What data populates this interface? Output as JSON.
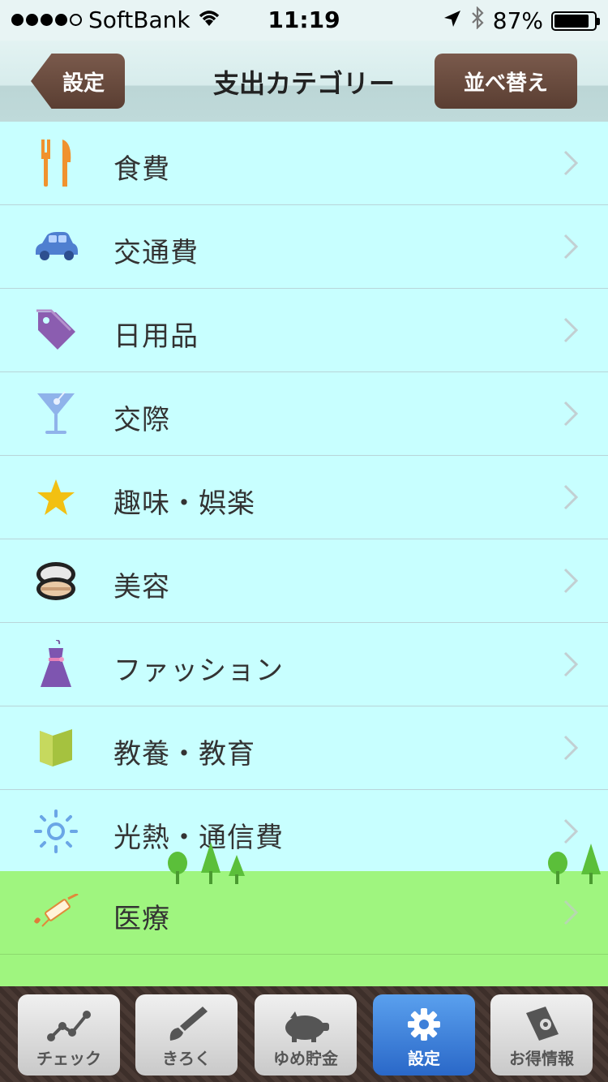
{
  "status_bar": {
    "carrier": "SoftBank",
    "time": "11:19",
    "battery": "87%",
    "signal_dots": 4
  },
  "nav": {
    "back_label": "設定",
    "title": "支出カテゴリー",
    "sort_label": "並べ替え"
  },
  "categories": [
    {
      "label": "食費",
      "icon": "fork-knife-icon"
    },
    {
      "label": "交通費",
      "icon": "car-icon"
    },
    {
      "label": "日用品",
      "icon": "tag-icon"
    },
    {
      "label": "交際",
      "icon": "cocktail-icon"
    },
    {
      "label": "趣味・娯楽",
      "icon": "star-icon"
    },
    {
      "label": "美容",
      "icon": "compact-icon"
    },
    {
      "label": "ファッション",
      "icon": "dress-icon"
    },
    {
      "label": "教養・教育",
      "icon": "book-icon"
    },
    {
      "label": "光熱・通信費",
      "icon": "sun-icon"
    },
    {
      "label": "医療",
      "icon": "syringe-icon"
    }
  ],
  "tabs": [
    {
      "label": "チェック",
      "icon": "chart-line-icon"
    },
    {
      "label": "きろく",
      "icon": "brush-icon"
    },
    {
      "label": "ゆめ貯金",
      "icon": "piggy-bank-icon"
    },
    {
      "label": "設定",
      "icon": "gear-icon",
      "active": true
    },
    {
      "label": "お得情報",
      "icon": "coupon-icon"
    }
  ],
  "colors": {
    "list_bg": "#c8ffff",
    "grass": "#9ff57f",
    "button_brown": "#6a4a3e",
    "tab_active": "#2a68c8"
  }
}
